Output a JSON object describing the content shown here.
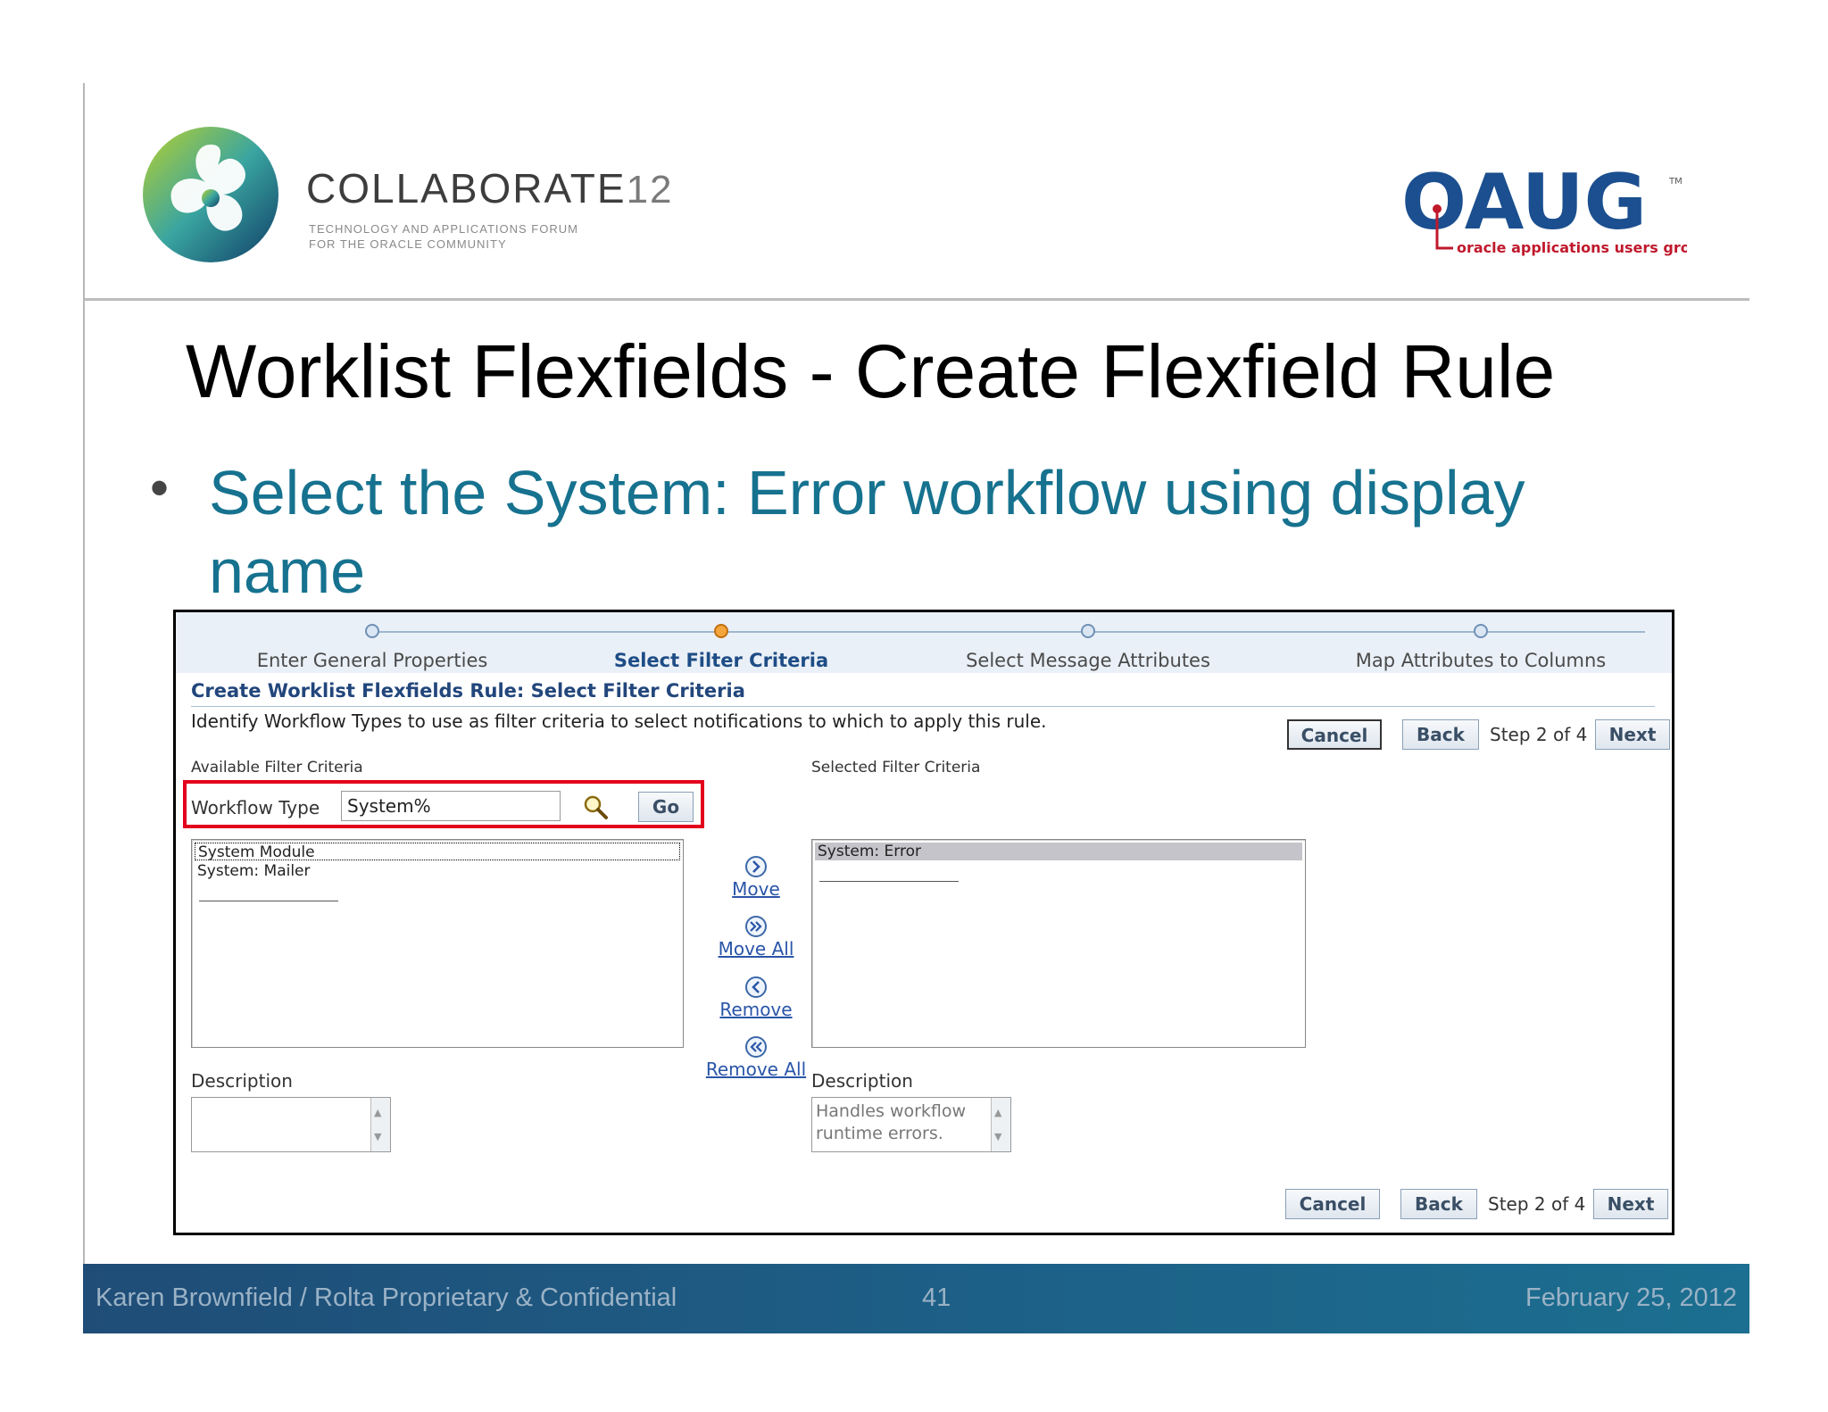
{
  "header": {
    "collaborate_name": "COLLABORATE",
    "collaborate_number": "12",
    "collaborate_tagline_1": "TECHNOLOGY AND APPLICATIONS FORUM",
    "collaborate_tagline_2": "FOR THE ORACLE COMMUNITY",
    "oaug_name": "OAUG",
    "oaug_tagline": "oracle applications users group",
    "oaug_tm": "TM"
  },
  "slide": {
    "title": "Worklist Flexfields - Create Flexfield Rule",
    "bullet": "Select the System: Error workflow using display name"
  },
  "train": {
    "steps": [
      {
        "label": "Enter General Properties",
        "active": false
      },
      {
        "label": "Select Filter Criteria",
        "active": true
      },
      {
        "label": "Select Message Attributes",
        "active": false
      },
      {
        "label": "Map Attributes to Columns",
        "active": false
      }
    ]
  },
  "form": {
    "header": "Create Worklist Flexfields Rule: Select Filter Criteria",
    "instructions": "Identify Workflow Types to use as filter criteria to select notifications to which to apply this rule.",
    "cancel_label": "Cancel",
    "back_label": "Back",
    "step_text": "Step 2 of 4",
    "next_label": "Next",
    "available_label": "Available Filter Criteria",
    "selected_label": "Selected Filter Criteria",
    "workflow_type_label": "Workflow Type",
    "workflow_type_value": "System%",
    "go_label": "Go",
    "available_items": [
      "System Module",
      "System: Mailer"
    ],
    "selected_items": [
      "System: Error"
    ],
    "move_label": "Move",
    "move_all_label": "Move All",
    "remove_label": "Remove",
    "remove_all_label": "Remove All",
    "description_label": "Description",
    "available_description": "",
    "selected_description": "Handles workflow runtime errors."
  },
  "footer": {
    "author": "Karen Brownfield  /  Rolta  Proprietary & Confidential",
    "page": "41",
    "date": "February 25, 2012"
  },
  "colors": {
    "bullet_text": "#16728f",
    "panel_header": "#22467c",
    "highlight_border": "#e3001b",
    "link": "#2a55a8",
    "active_step_dot": "#f4a53c",
    "footer_bg": "#1d6087"
  },
  "icons": {
    "search": "magnifier-icon",
    "move": "move-right-icon",
    "move_all": "move-all-right-icon",
    "remove": "remove-left-icon",
    "remove_all": "remove-all-left-icon"
  }
}
